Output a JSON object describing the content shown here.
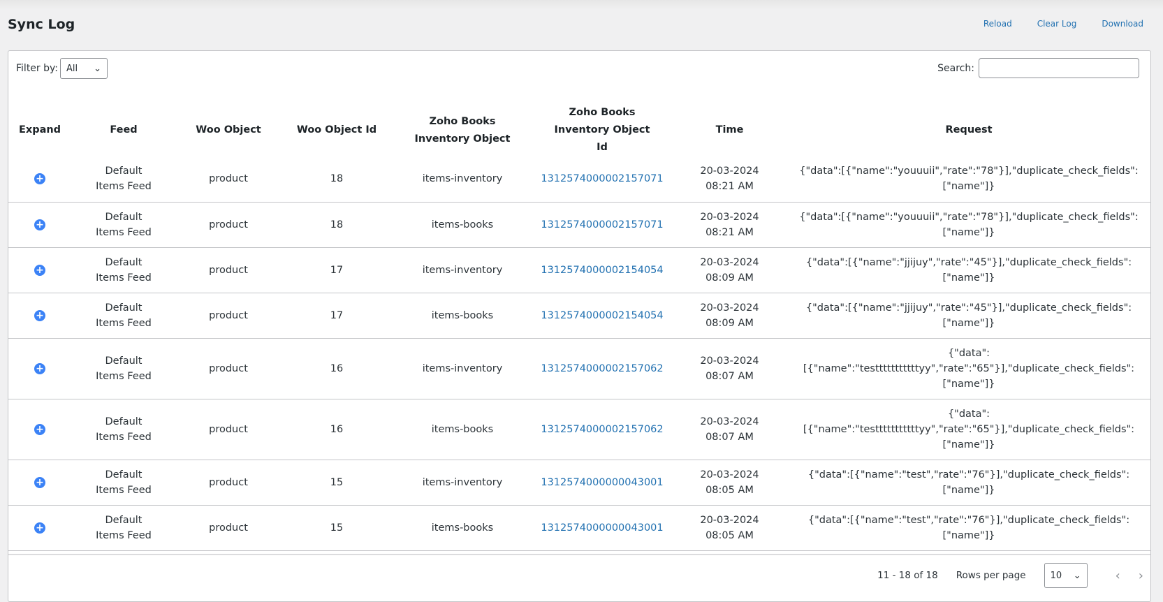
{
  "header": {
    "title": "Sync Log",
    "actions": [
      "Reload",
      "Clear Log",
      "Download"
    ]
  },
  "filter": {
    "label": "Filter by:",
    "value": "All"
  },
  "search": {
    "label": "Search:",
    "value": ""
  },
  "columns": [
    "Expand",
    "Feed",
    "Woo Object",
    "Woo Object Id",
    "Zoho Books Inventory Object",
    "Zoho Books Inventory Object Id",
    "Time",
    "Request"
  ],
  "rows": [
    {
      "feed": "Default Items Feed",
      "woo_object": "product",
      "woo_id": "18",
      "zoho_object": "items-inventory",
      "zoho_id": "1312574000002157071",
      "time": "20-03-2024 08:21 AM",
      "request": "{\"data\":[{\"name\":\"youuuii\",\"rate\":\"78\"}],\"duplicate_check_fields\":[\"name\"]}"
    },
    {
      "feed": "Default Items Feed",
      "woo_object": "product",
      "woo_id": "18",
      "zoho_object": "items-books",
      "zoho_id": "1312574000002157071",
      "time": "20-03-2024 08:21 AM",
      "request": "{\"data\":[{\"name\":\"youuuii\",\"rate\":\"78\"}],\"duplicate_check_fields\":[\"name\"]}"
    },
    {
      "feed": "Default Items Feed",
      "woo_object": "product",
      "woo_id": "17",
      "zoho_object": "items-inventory",
      "zoho_id": "1312574000002154054",
      "time": "20-03-2024 08:09 AM",
      "request": "{\"data\":[{\"name\":\"jjijuy\",\"rate\":\"45\"}],\"duplicate_check_fields\":[\"name\"]}"
    },
    {
      "feed": "Default Items Feed",
      "woo_object": "product",
      "woo_id": "17",
      "zoho_object": "items-books",
      "zoho_id": "1312574000002154054",
      "time": "20-03-2024 08:09 AM",
      "request": "{\"data\":[{\"name\":\"jjijuy\",\"rate\":\"45\"}],\"duplicate_check_fields\":[\"name\"]}"
    },
    {
      "feed": "Default Items Feed",
      "woo_object": "product",
      "woo_id": "16",
      "zoho_object": "items-inventory",
      "zoho_id": "1312574000002157062",
      "time": "20-03-2024 08:07 AM",
      "request": "{\"data\":[{\"name\":\"testttttttttttyy\",\"rate\":\"65\"}],\"duplicate_check_fields\":[\"name\"]}"
    },
    {
      "feed": "Default Items Feed",
      "woo_object": "product",
      "woo_id": "16",
      "zoho_object": "items-books",
      "zoho_id": "1312574000002157062",
      "time": "20-03-2024 08:07 AM",
      "request": "{\"data\":[{\"name\":\"testttttttttttyy\",\"rate\":\"65\"}],\"duplicate_check_fields\":[\"name\"]}"
    },
    {
      "feed": "Default Items Feed",
      "woo_object": "product",
      "woo_id": "15",
      "zoho_object": "items-inventory",
      "zoho_id": "1312574000000043001",
      "time": "20-03-2024 08:05 AM",
      "request": "{\"data\":[{\"name\":\"test\",\"rate\":\"76\"}],\"duplicate_check_fields\":[\"name\"]}"
    },
    {
      "feed": "Default Items Feed",
      "woo_object": "product",
      "woo_id": "15",
      "zoho_object": "items-books",
      "zoho_id": "1312574000000043001",
      "time": "20-03-2024 08:05 AM",
      "request": "{\"data\":[{\"name\":\"test\",\"rate\":\"76\"}],\"duplicate_check_fields\":[\"name\"]}"
    }
  ],
  "pagination": {
    "range": "11 - 18 of 18",
    "rows_per_page_label": "Rows per page",
    "rows_per_page": "10"
  },
  "colors": {
    "link": "#2271b1",
    "expand": "#3b82f6"
  }
}
